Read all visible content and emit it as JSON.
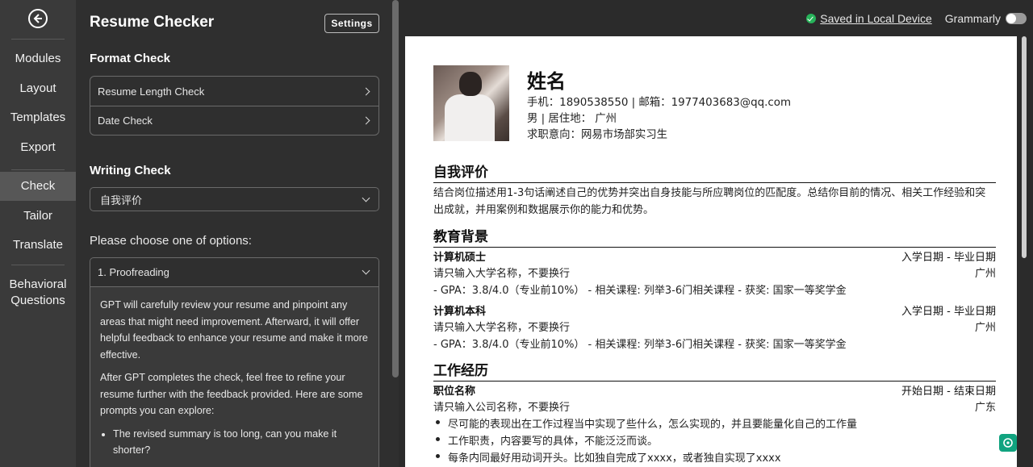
{
  "rail": {
    "items": [
      "Modules",
      "Layout",
      "Templates",
      "Export",
      "Check",
      "Tailor",
      "Translate",
      "Behavioral Questions"
    ],
    "active": "Check"
  },
  "panel": {
    "title": "Resume Checker",
    "settings_label": "Settings",
    "format_check": {
      "title": "Format Check",
      "items": [
        "Resume Length Check",
        "Date Check"
      ]
    },
    "writing_check": {
      "title": "Writing Check",
      "selected": "自我评价"
    },
    "choose_label": "Please choose one of options:",
    "option": {
      "label": "1. Proofreading",
      "paragraph1": "GPT will carefully review your resume and pinpoint any areas that might need improvement. Afterward, it will offer helpful feedback to enhance your resume and make it more effective.",
      "paragraph2": "After GPT completes the check, feel free to refine your resume further with the feedback provided. Here are some prompts you can explore:",
      "prompts": [
        "The revised summary is too long, can you make it shorter?"
      ]
    }
  },
  "topbar": {
    "saved_label": "Saved in Local Device",
    "grammarly_label": "Grammarly"
  },
  "resume": {
    "name": "姓名",
    "contact": "手机：1890538550 | 邮箱：1977403683@qq.com",
    "gender_location": "男 | 居住地： 广州",
    "objective": "求职意向：网易市场部实习生",
    "sections": {
      "self_eval": {
        "title": "自我评价",
        "text": "结合岗位描述用1-3句话阐述自己的优势并突出自身技能与所应聘岗位的匹配度。总结你目前的情况、相关工作经验和突出成就，并用案例和数据展示你的能力和优势。"
      },
      "education": {
        "title": "教育背景",
        "entries": [
          {
            "degree": "计算机硕士",
            "dates": "入学日期 - 毕业日期",
            "school": "请只输入大学名称，不要换行",
            "city": "广州",
            "detail": "- GPA：3.8/4.0（专业前10%） - 相关课程: 列举3-6门相关课程 - 获奖: 国家一等奖学金"
          },
          {
            "degree": "计算机本科",
            "dates": "入学日期 - 毕业日期",
            "school": "请只输入大学名称，不要换行",
            "city": "广州",
            "detail": "- GPA：3.8/4.0（专业前10%） - 相关课程: 列举3-6门相关课程 - 获奖: 国家一等奖学金"
          }
        ]
      },
      "work": {
        "title": "工作经历",
        "position": "职位名称",
        "dates": "开始日期 - 结束日期",
        "company": "请只输入公司名称，不要换行",
        "city": "广东",
        "bullets": [
          "尽可能的表现出在工作过程当中实现了些什么，怎么实现的，并且要能量化自己的工作量",
          "工作职责，内容要写的具体，不能泛泛而谈。",
          "每条内同最好用动词开头。比如独自完成了xxxx，或者独自实现了xxxx"
        ]
      }
    }
  }
}
